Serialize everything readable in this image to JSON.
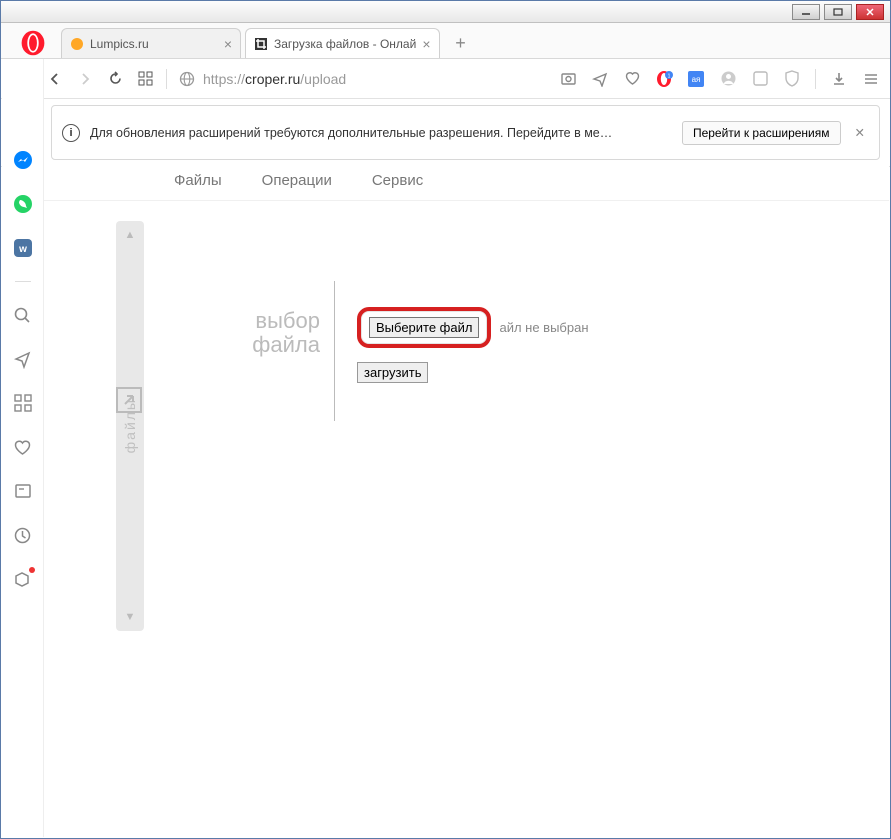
{
  "window": {
    "minimize": "—",
    "maximize": "▭",
    "close": "✕"
  },
  "tabs": {
    "items": [
      {
        "title": "Lumpics.ru",
        "active": false
      },
      {
        "title": "Загрузка файлов - Онлай",
        "active": true
      }
    ]
  },
  "address": {
    "protocol": "https://",
    "host": "croper.ru",
    "path": "/upload"
  },
  "notification": {
    "text": "Для обновления расширений требуются дополнительные разрешения. Перейдите в ме…",
    "button": "Перейти к расширениям",
    "close": "✕"
  },
  "extension_sidebar": {
    "translate_label": "aя",
    "add": "+"
  },
  "site_menu": {
    "files": "Файлы",
    "operations": "Операции",
    "service": "Сервис"
  },
  "drawer": {
    "label": "файлы"
  },
  "upload": {
    "label_line1": "выбор",
    "label_line2": "файла",
    "choose_button": "Выберите файл",
    "status": "айл не выбран",
    "load_button": "загрузить"
  }
}
